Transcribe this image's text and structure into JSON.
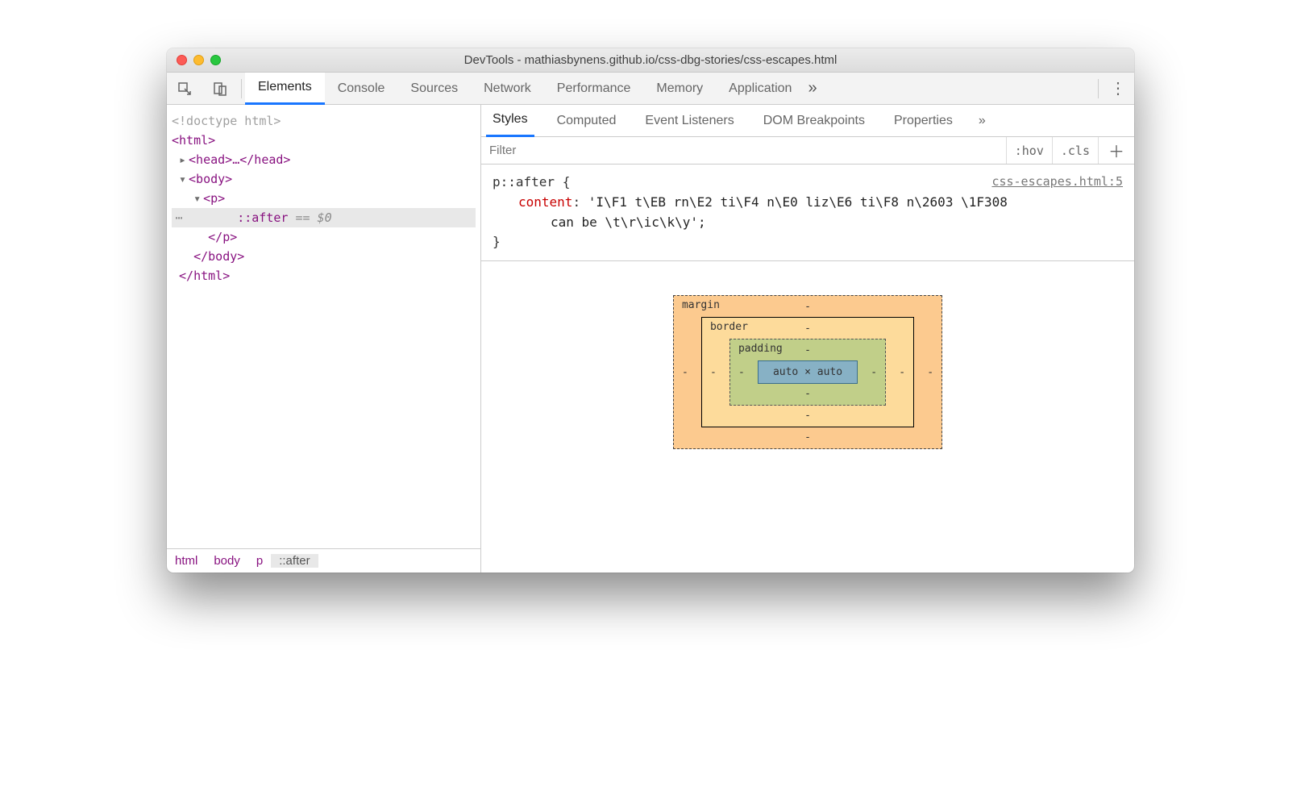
{
  "window": {
    "title": "DevTools - mathiasbynens.github.io/css-dbg-stories/css-escapes.html"
  },
  "main_tabs": {
    "items": [
      "Elements",
      "Console",
      "Sources",
      "Network",
      "Performance",
      "Memory",
      "Application"
    ],
    "active": 0,
    "more": "»"
  },
  "dom": {
    "doctype": "<!doctype html>",
    "html_open": "<html>",
    "head": "<head>…</head>",
    "body_open": "<body>",
    "p_open": "<p>",
    "after": "::after",
    "eq": " == $0",
    "p_close": "</p>",
    "body_close": "</body>",
    "html_close": "</html>"
  },
  "breadcrumbs": [
    "html",
    "body",
    "p",
    "::after"
  ],
  "styles_tabs": {
    "items": [
      "Styles",
      "Computed",
      "Event Listeners",
      "DOM Breakpoints",
      "Properties"
    ],
    "active": 0,
    "more": "»"
  },
  "filter": {
    "placeholder": "Filter",
    "hov": ":hov",
    "cls": ".cls"
  },
  "rule": {
    "selector": "p::after {",
    "source": "css-escapes.html:5",
    "prop": "content",
    "val_line1": "'I\\F1 t\\EB rn\\E2 ti\\F4 n\\E0 liz\\E6 ti\\F8 n\\2603 \\1F308",
    "val_line2": "can be \\t\\r\\ic\\k\\y';",
    "close": "}"
  },
  "boxmodel": {
    "margin_label": "margin",
    "border_label": "border",
    "padding_label": "padding",
    "dash": "-",
    "content": "auto × auto"
  }
}
